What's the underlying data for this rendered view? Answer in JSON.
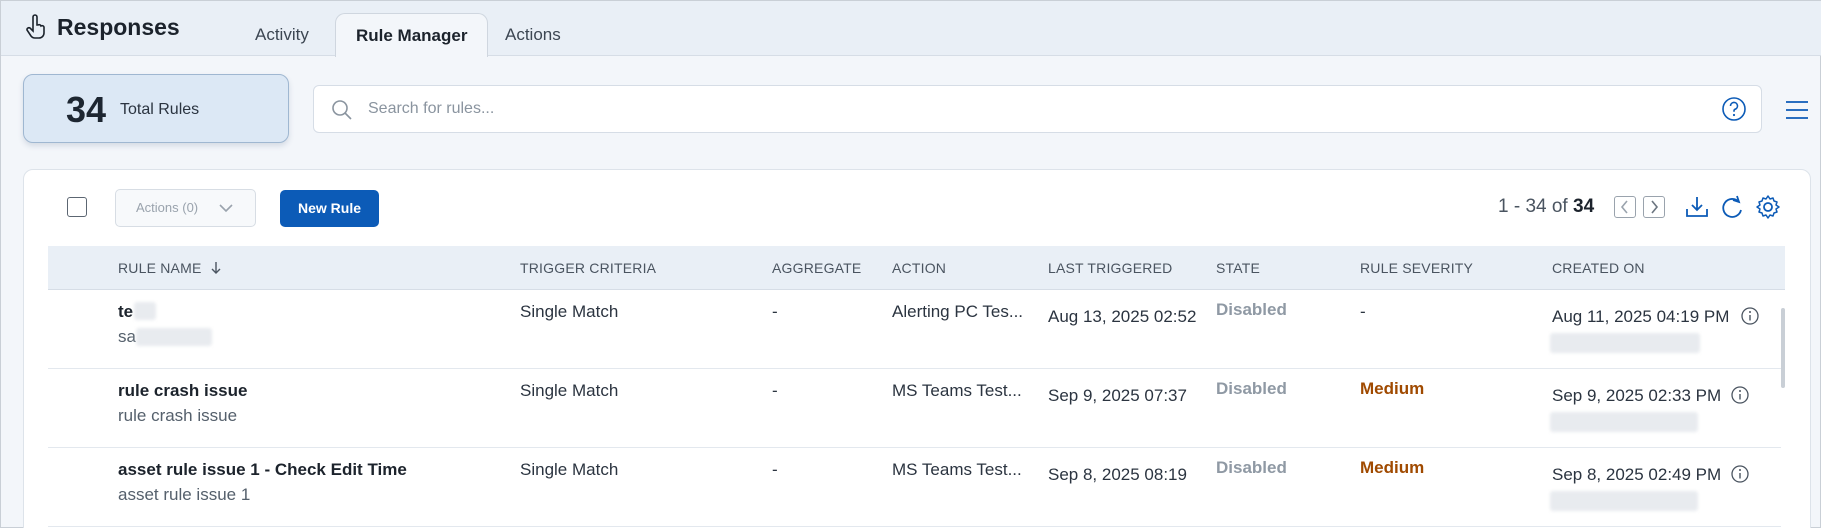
{
  "app": {
    "title": "Responses"
  },
  "tabs": [
    {
      "label": "Activity"
    },
    {
      "label": "Rule Manager"
    },
    {
      "label": "Actions"
    }
  ],
  "stats": {
    "total_count": "34",
    "total_label": "Total Rules"
  },
  "search": {
    "placeholder": "Search for rules..."
  },
  "toolbar": {
    "actions_label": "Actions (0)",
    "new_rule_label": "New Rule"
  },
  "pagination": {
    "range": "1 - 34 of",
    "total": "34"
  },
  "table": {
    "columns": [
      "RULE NAME",
      "TRIGGER CRITERIA",
      "AGGREGATE",
      "ACTION",
      "LAST TRIGGERED",
      "STATE",
      "RULE SEVERITY",
      "CREATED ON"
    ],
    "rows": [
      {
        "name": "te",
        "description": "sa",
        "trigger": "Single Match",
        "aggregate": "-",
        "action": "Alerting PC Tes...",
        "last_triggered": "Aug 13, 2025 02:52",
        "state": "Disabled",
        "severity": "-",
        "created_on": "Aug 11, 2025 04:19 PM"
      },
      {
        "name": "rule crash issue",
        "description": "rule crash issue",
        "trigger": "Single Match",
        "aggregate": "-",
        "action": "MS Teams Test...",
        "last_triggered": "Sep 9, 2025 07:37",
        "state": "Disabled",
        "severity": "Medium",
        "created_on": "Sep 9, 2025 02:33 PM"
      },
      {
        "name": "asset rule issue 1 - Check Edit Time",
        "description": "asset rule issue 1",
        "trigger": "Single Match",
        "aggregate": "-",
        "action": "MS Teams Test...",
        "last_triggered": "Sep 8, 2025 08:19",
        "state": "Disabled",
        "severity": "Medium",
        "created_on": "Sep 8, 2025 02:49 PM"
      }
    ]
  },
  "colors": {
    "primary": "#0c5bb7",
    "severity_medium": "#a04a00",
    "state_disabled": "#8f99a4"
  }
}
